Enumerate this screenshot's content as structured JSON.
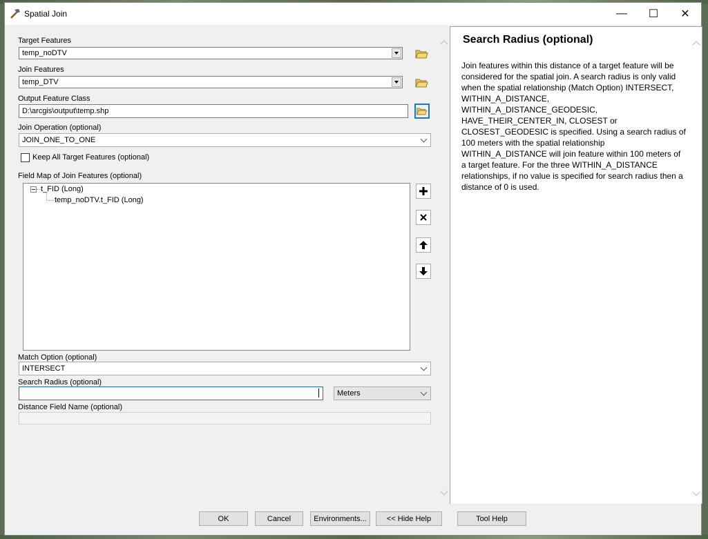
{
  "window": {
    "title": "Spatial Join"
  },
  "controls": {
    "minimize": "—",
    "maximize": "☐",
    "close": "✕"
  },
  "form": {
    "target_features": {
      "label": "Target Features",
      "value": "temp_noDTV"
    },
    "join_features": {
      "label": "Join Features",
      "value": "temp_DTV"
    },
    "output_feature_class": {
      "label": "Output Feature Class",
      "value": "D:\\arcgis\\output\\temp.shp"
    },
    "join_operation": {
      "label": "Join Operation (optional)",
      "value": "JOIN_ONE_TO_ONE"
    },
    "keep_all": {
      "label": "Keep All Target Features (optional)",
      "checked": false
    },
    "field_map": {
      "label": "Field Map of Join Features (optional)",
      "node": "t_FID (Long)",
      "child": "temp_noDTV.t_FID (Long)"
    },
    "match_option": {
      "label": "Match Option (optional)",
      "value": "INTERSECT"
    },
    "search_radius": {
      "label": "Search Radius (optional)",
      "value": "",
      "unit": "Meters"
    },
    "distance_field": {
      "label": "Distance Field Name (optional)",
      "value": ""
    }
  },
  "help": {
    "title": "Search Radius (optional)",
    "body": "Join features within this distance of a target feature will be considered for the spatial join. A search radius is only valid when the spatial relationship (Match Option) INTERSECT, WITHIN_A_DISTANCE, WITHIN_A_DISTANCE_GEODESIC, HAVE_THEIR_CENTER_IN, CLOSEST or CLOSEST_GEODESIC is specified. Using a search radius of 100 meters with the spatial relationship WITHIN_A_DISTANCE will join feature within 100 meters of a target feature. For the three WITHIN_A_DISTANCE relationships, if no value is specified for search radius then a distance of 0 is used."
  },
  "buttons": {
    "ok": "OK",
    "cancel": "Cancel",
    "environments": "Environments...",
    "hide_help": "<< Hide Help",
    "tool_help": "Tool Help"
  }
}
